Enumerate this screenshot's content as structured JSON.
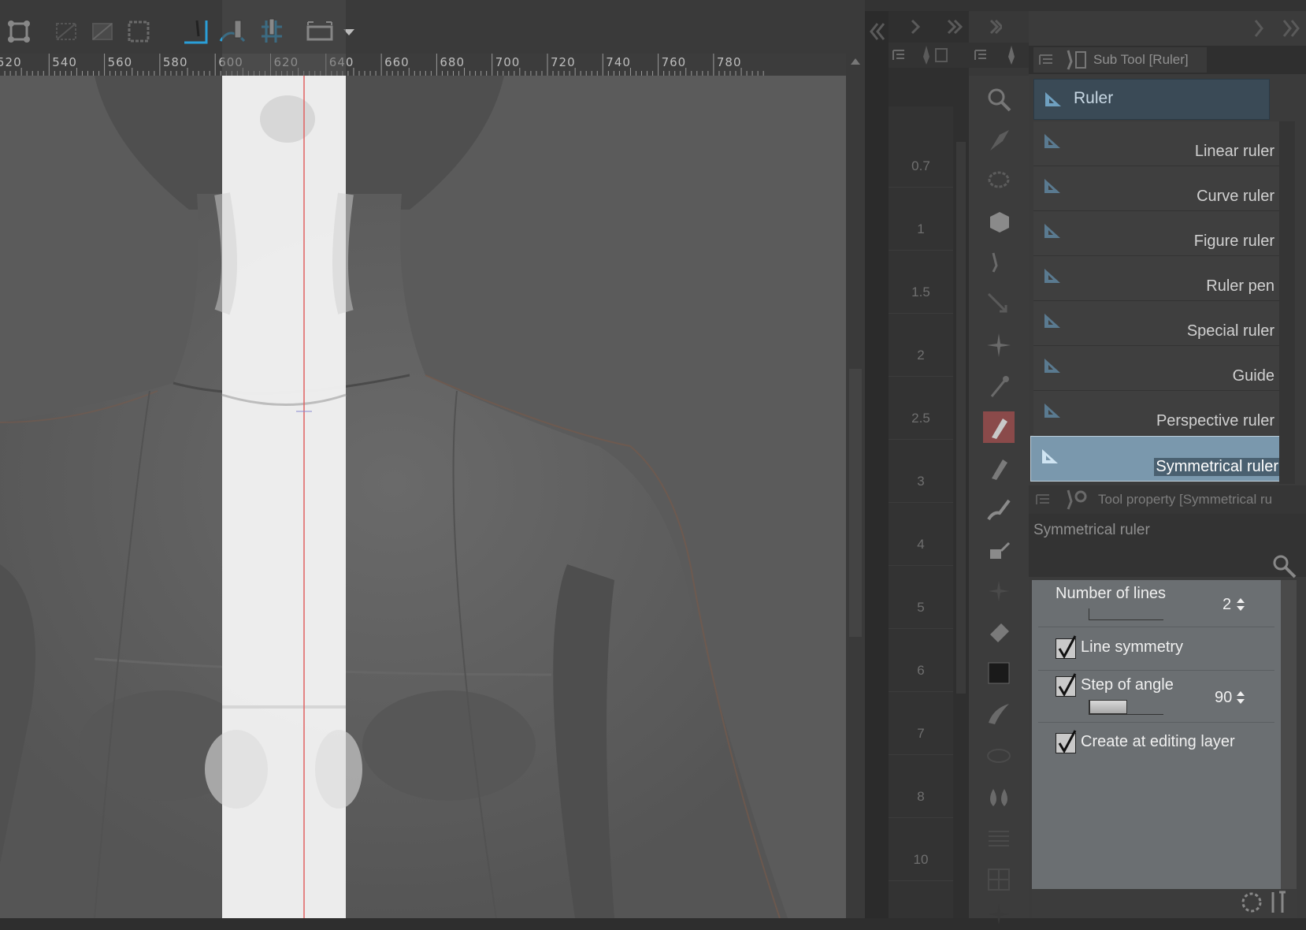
{
  "ruler": {
    "labels": [
      "520",
      "540",
      "560",
      "580",
      "600",
      "620",
      "640",
      "660",
      "680",
      "700",
      "720",
      "740",
      "760",
      "780"
    ]
  },
  "navigator": {
    "values": [
      "0.7",
      "1",
      "1.5",
      "2",
      "2.5",
      "3",
      "4",
      "5",
      "6",
      "7",
      "8",
      "10"
    ]
  },
  "subtool_panel": {
    "title": "Sub Tool [Ruler]",
    "group_label": "Ruler",
    "items": [
      {
        "label": "Linear ruler"
      },
      {
        "label": "Curve ruler"
      },
      {
        "label": "Figure ruler"
      },
      {
        "label": "Ruler pen"
      },
      {
        "label": "Special ruler"
      },
      {
        "label": "Guide"
      },
      {
        "label": "Perspective ruler"
      },
      {
        "label": "Symmetrical ruler"
      }
    ],
    "selected": "Symmetrical ruler"
  },
  "tool_property": {
    "title": "Tool property [Symmetrical ru",
    "tool_name": "Symmetrical ruler",
    "number_of_lines_label": "Number of lines",
    "number_of_lines_value": "2",
    "line_symmetry_label": "Line symmetry",
    "line_symmetry_checked": true,
    "step_of_angle_label": "Step of angle",
    "step_of_angle_value": "90",
    "step_of_angle_checked": true,
    "create_at_editing_layer_label": "Create at editing layer",
    "create_at_editing_layer_checked": true
  },
  "colors": {
    "accent": "#2a9fd8",
    "selected_bg": "#7a98ad",
    "highlight_band": "#f2f2f2",
    "guide_line": "#e06060"
  }
}
